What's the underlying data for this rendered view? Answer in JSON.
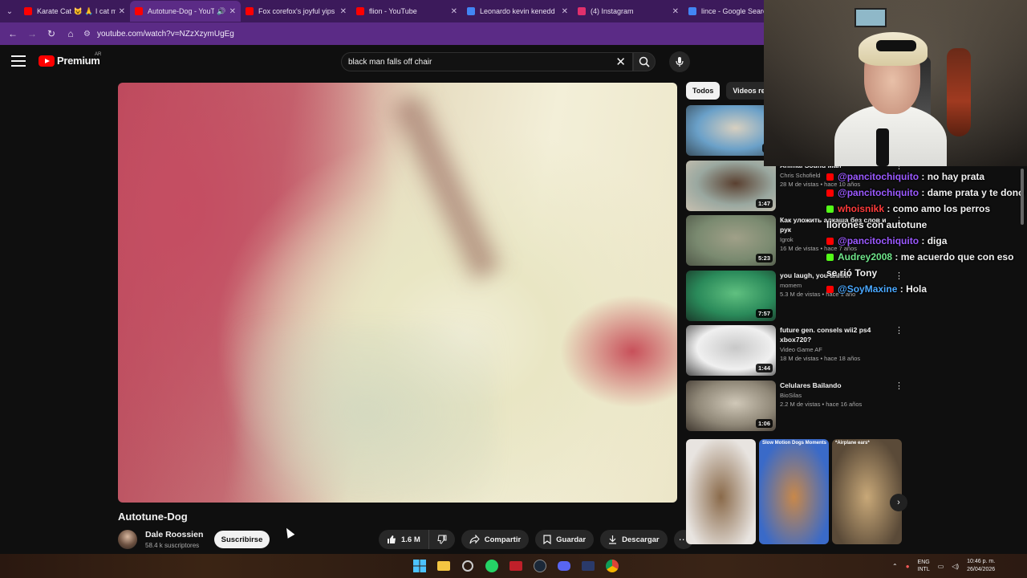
{
  "browser": {
    "tabs": [
      {
        "title": "Karate Cat 😺 🙏 I cat me",
        "favicon_color": "#ff0000",
        "active": false
      },
      {
        "title": "Autotune-Dog - YouT",
        "favicon_color": "#ff0000",
        "active": true,
        "audio": true
      },
      {
        "title": "Fox corefox's joyful yips",
        "favicon_color": "#ff0000",
        "active": false
      },
      {
        "title": "flion - YouTube",
        "favicon_color": "#ff0000",
        "active": false
      },
      {
        "title": "Leonardo kevin kenedd",
        "favicon_color": "#4285f4",
        "active": false
      },
      {
        "title": "(4) Instagram",
        "favicon_color": "#e1306c",
        "active": false
      },
      {
        "title": "lince - Google Search",
        "favicon_color": "#4285f4",
        "active": false
      }
    ],
    "url": "youtube.com/watch?v=NZzXzymUgEg"
  },
  "youtube": {
    "logo_text": "Premium",
    "country": "AR",
    "search_query": "black man falls off chair"
  },
  "video": {
    "title": "Autotune-Dog",
    "channel": "Dale Roossien",
    "subscribers": "58.4 k suscriptores",
    "subscribe_label": "Suscribirse",
    "likes": "1.6 M",
    "share_label": "Compartir",
    "save_label": "Guardar",
    "download_label": "Descargar"
  },
  "chips": [
    "Todos",
    "Videos rel"
  ],
  "recommendations": [
    {
      "title": "",
      "channel": "",
      "views": "",
      "duration": "1:",
      "colors": [
        "#6aa0c8",
        "#d8d0c0",
        "#3a5060"
      ]
    },
    {
      "title": "Animal Sound Man",
      "channel": "Chris Schofield",
      "views": "28 M de vistas • hace 10 años",
      "duration": "1:47",
      "colors": [
        "#9aa8a0",
        "#5a4030",
        "#c8c0b0"
      ]
    },
    {
      "title": "Как уложить алкаша без слов и рук",
      "channel": "Igrok",
      "views": "16 M de vistas • hace 7 años",
      "duration": "5:23",
      "colors": [
        "#7a8a70",
        "#a0a088",
        "#505848"
      ]
    },
    {
      "title": "you laugh, you ahhhh",
      "channel": "momem",
      "views": "5.3 M de vistas • hace 1 año",
      "duration": "7:57",
      "colors": [
        "#2a8a5a",
        "#60c080",
        "#1a3a2a"
      ]
    },
    {
      "title": "future gen. consels wii2 ps4 xbox720?",
      "channel": "Video Game AF",
      "views": "18 M de vistas • hace 18 años",
      "duration": "1:44",
      "colors": [
        "#f0f0f0",
        "#c8c8c8",
        "#505050"
      ]
    },
    {
      "title": "Celulares Bailando",
      "channel": "BioSilas",
      "views": "2.2 M de vistas • hace 16 años",
      "duration": "1:06",
      "colors": [
        "#908878",
        "#d0c8b8",
        "#403830"
      ]
    }
  ],
  "shorts": [
    {
      "label": "",
      "colors": [
        "#e8e4e0",
        "#8a6a4a"
      ]
    },
    {
      "label": "Slow Motion Dogs Moments",
      "colors": [
        "#3a6ac8",
        "#c8884a"
      ]
    },
    {
      "label": "*Airplane ears*",
      "colors": [
        "#5a4a38",
        "#c8a878"
      ]
    }
  ],
  "chat": [
    {
      "platform": "youtube",
      "user": "@pancitochiquito",
      "user_color": "#9b59ff",
      "text": "no hay prata"
    },
    {
      "platform": "youtube",
      "user": "@pancitochiquito",
      "user_color": "#9b59ff",
      "text": "dame prata y te dono"
    },
    {
      "platform": "kick",
      "user": "whoisnikk",
      "user_color": "#ff3b3b",
      "text": "como amo los perros llorones con autotune"
    },
    {
      "platform": "youtube",
      "user": "@pancitochiquito",
      "user_color": "#9b59ff",
      "text": "diga"
    },
    {
      "platform": "kick",
      "user": "Audrey2008",
      "user_color": "#6fe58a",
      "text": "me acuerdo que con eso se rió Tony"
    },
    {
      "platform": "youtube",
      "user": "@SoyMaxine",
      "user_color": "#4aa8ff",
      "text": "Hola"
    }
  ],
  "taskbar": {
    "language": "ENG",
    "layout": "INTL",
    "time": "10:46 p. m.",
    "date": "26/04/2026"
  }
}
